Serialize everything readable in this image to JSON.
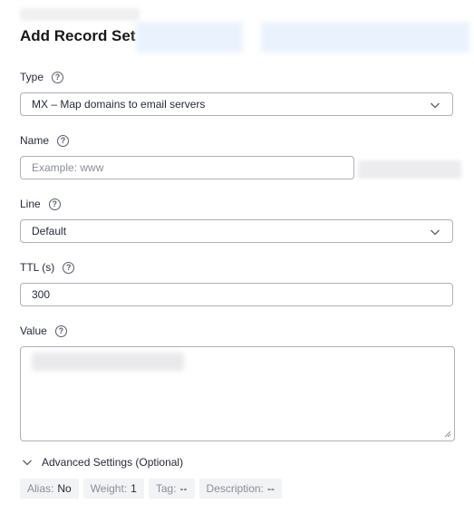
{
  "dialog": {
    "title": "Add Record Set"
  },
  "fields": {
    "type": {
      "label": "Type",
      "value": "MX – Map domains to email servers"
    },
    "name": {
      "label": "Name",
      "placeholder": "Example: www"
    },
    "line": {
      "label": "Line",
      "value": "Default"
    },
    "ttl": {
      "label": "TTL (s)",
      "value": "300"
    },
    "value": {
      "label": "Value"
    }
  },
  "help_glyph": "?",
  "advanced": {
    "label": "Advanced Settings (Optional)"
  },
  "tags": [
    {
      "key": "Alias:",
      "value": "No"
    },
    {
      "key": "Weight:",
      "value": "1"
    },
    {
      "key": "Tag:",
      "value": "--"
    },
    {
      "key": "Description:",
      "value": "--"
    }
  ],
  "colors": {
    "text": "#252b3a",
    "border": "#adb0b8",
    "tag_bg": "#f2f3f5",
    "muted": "#8a8e99"
  }
}
